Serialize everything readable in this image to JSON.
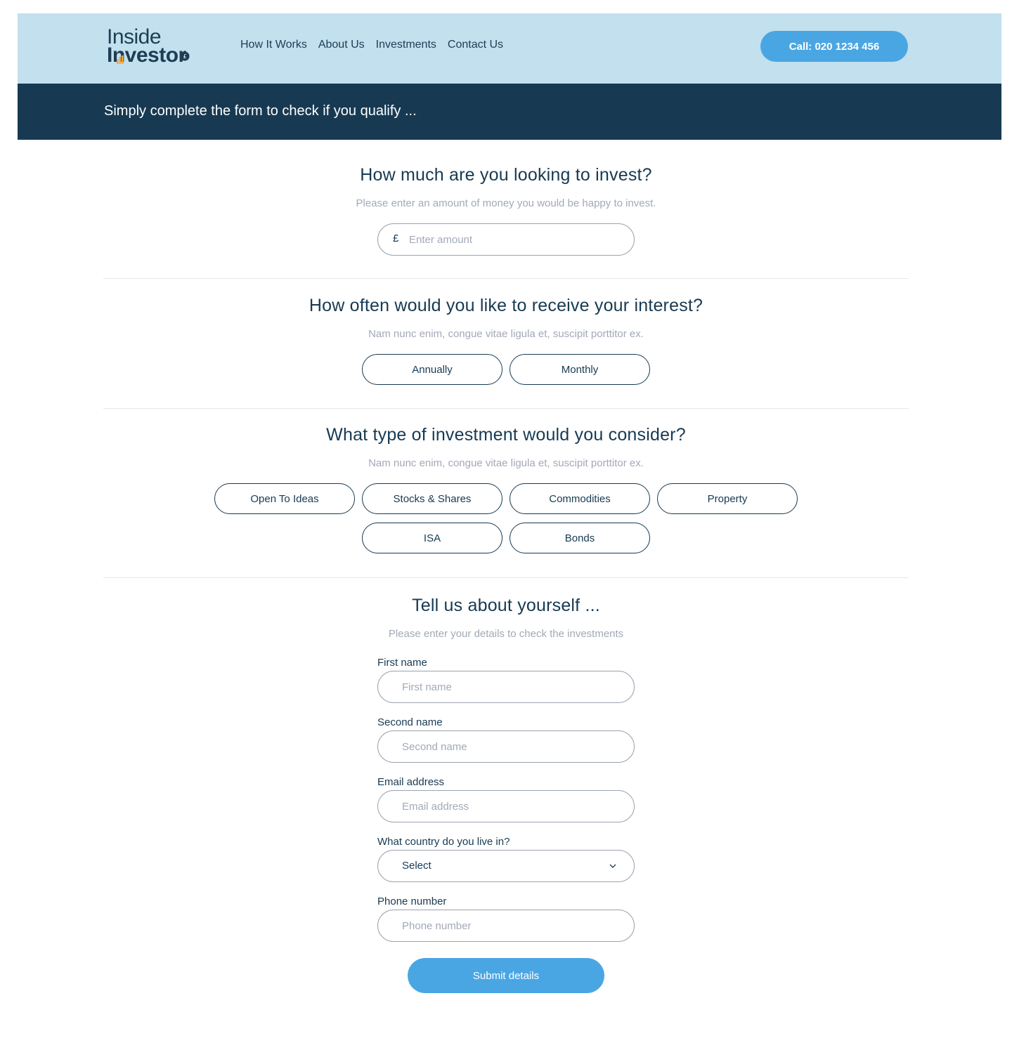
{
  "header": {
    "logo_line1": "Inside",
    "logo_line2": "Investor",
    "nav": [
      "How It Works",
      "About Us",
      "Investments",
      "Contact Us"
    ],
    "call_button": "Call: 020 1234 456"
  },
  "banner": {
    "text": "Simply complete the form to check if you qualify ..."
  },
  "invest": {
    "title": "How much are you looking to invest?",
    "subtitle": "Please enter an amount of money you would be happy to invest.",
    "currency_symbol": "£",
    "placeholder": "Enter amount"
  },
  "interest": {
    "title": "How often would you like to receive your interest?",
    "subtitle": "Nam nunc enim, congue vitae ligula et, suscipit porttitor ex.",
    "options": [
      "Annually",
      "Monthly"
    ]
  },
  "type": {
    "title": "What type of investment would you consider?",
    "subtitle": "Nam nunc enim, congue vitae ligula et, suscipit porttitor ex.",
    "options": [
      "Open To Ideas",
      "Stocks & Shares",
      "Commodities",
      "Property",
      "ISA",
      "Bonds"
    ]
  },
  "about": {
    "title": "Tell us about yourself ...",
    "subtitle": "Please enter your details to check the investments",
    "first_name": {
      "label": "First name",
      "placeholder": "First name"
    },
    "second_name": {
      "label": "Second name",
      "placeholder": "Second name"
    },
    "email": {
      "label": "Email address",
      "placeholder": "Email address"
    },
    "country": {
      "label": "What country do you live in?",
      "value": "Select"
    },
    "phone": {
      "label": "Phone number",
      "placeholder": "Phone number"
    },
    "submit": "Submit details"
  },
  "colors": {
    "header_bg": "#c2e0ee",
    "banner_bg": "#173a52",
    "accent": "#4aa6e3",
    "logo_accent": "#f0a53a"
  }
}
